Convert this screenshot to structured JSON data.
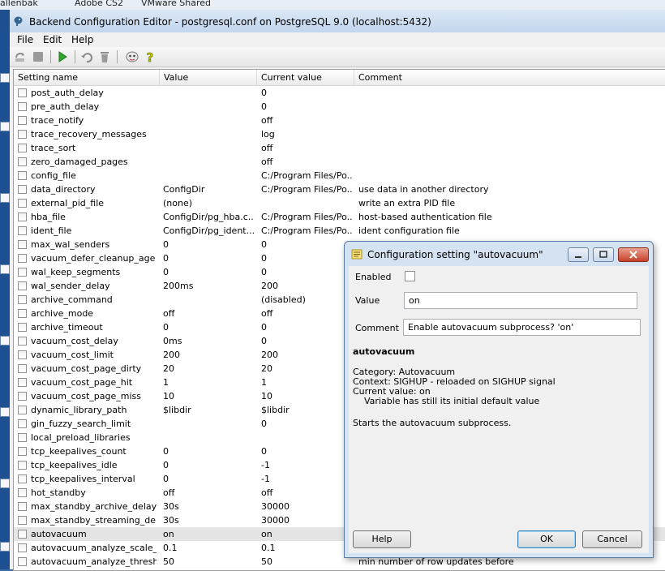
{
  "desktop": {
    "labels": [
      "allenbak",
      "Adobe CS2",
      "VMware Shared"
    ]
  },
  "window": {
    "title": "Backend Configuration Editor - postgresql.conf on PostgreSQL 9.0 (localhost:5432)"
  },
  "menu": [
    "File",
    "Edit",
    "Help"
  ],
  "columns": [
    "Setting name",
    "Value",
    "Current value",
    "Comment"
  ],
  "rows": [
    {
      "name": "post_auth_delay",
      "value": "",
      "current": "0",
      "comment": ""
    },
    {
      "name": "pre_auth_delay",
      "value": "",
      "current": "0",
      "comment": ""
    },
    {
      "name": "trace_notify",
      "value": "",
      "current": "off",
      "comment": ""
    },
    {
      "name": "trace_recovery_messages",
      "value": "",
      "current": "log",
      "comment": ""
    },
    {
      "name": "trace_sort",
      "value": "",
      "current": "off",
      "comment": ""
    },
    {
      "name": "zero_damaged_pages",
      "value": "",
      "current": "off",
      "comment": ""
    },
    {
      "name": "config_file",
      "value": "",
      "current": "C:/Program Files/Po...",
      "comment": ""
    },
    {
      "name": "data_directory",
      "value": "ConfigDir",
      "current": "C:/Program Files/Po...",
      "comment": "use data in another directory"
    },
    {
      "name": "external_pid_file",
      "value": "(none)",
      "current": "",
      "comment": "write an extra PID file"
    },
    {
      "name": "hba_file",
      "value": "ConfigDir/pg_hba.c...",
      "current": "C:/Program Files/Po...",
      "comment": "host-based authentication file"
    },
    {
      "name": "ident_file",
      "value": "ConfigDir/pg_ident....",
      "current": "C:/Program Files/Po...",
      "comment": "ident configuration file"
    },
    {
      "name": "max_wal_senders",
      "value": "0",
      "current": "0",
      "comment": ""
    },
    {
      "name": "vacuum_defer_cleanup_age",
      "value": "0",
      "current": "0",
      "comment": ""
    },
    {
      "name": "wal_keep_segments",
      "value": "0",
      "current": "0",
      "comment": ""
    },
    {
      "name": "wal_sender_delay",
      "value": "200ms",
      "current": "200",
      "comment": ""
    },
    {
      "name": "archive_command",
      "value": "",
      "current": "(disabled)",
      "comment": ""
    },
    {
      "name": "archive_mode",
      "value": "off",
      "current": "off",
      "comment": ""
    },
    {
      "name": "archive_timeout",
      "value": "0",
      "current": "0",
      "comment": ""
    },
    {
      "name": "vacuum_cost_delay",
      "value": "0ms",
      "current": "0",
      "comment": ""
    },
    {
      "name": "vacuum_cost_limit",
      "value": "200",
      "current": "200",
      "comment": ""
    },
    {
      "name": "vacuum_cost_page_dirty",
      "value": "20",
      "current": "20",
      "comment": ""
    },
    {
      "name": "vacuum_cost_page_hit",
      "value": "1",
      "current": "1",
      "comment": ""
    },
    {
      "name": "vacuum_cost_page_miss",
      "value": "10",
      "current": "10",
      "comment": ""
    },
    {
      "name": "dynamic_library_path",
      "value": "$libdir",
      "current": "$libdir",
      "comment": ""
    },
    {
      "name": "gin_fuzzy_search_limit",
      "value": "",
      "current": "0",
      "comment": ""
    },
    {
      "name": "local_preload_libraries",
      "value": "",
      "current": "",
      "comment": ""
    },
    {
      "name": "tcp_keepalives_count",
      "value": "0",
      "current": "0",
      "comment": ""
    },
    {
      "name": "tcp_keepalives_idle",
      "value": "0",
      "current": "-1",
      "comment": ""
    },
    {
      "name": "tcp_keepalives_interval",
      "value": "0",
      "current": "-1",
      "comment": ""
    },
    {
      "name": "hot_standby",
      "value": "off",
      "current": "off",
      "comment": ""
    },
    {
      "name": "max_standby_archive_delay",
      "value": "30s",
      "current": "30000",
      "comment": ""
    },
    {
      "name": "max_standby_streaming_delay",
      "value": "30s",
      "current": "30000",
      "comment": ""
    },
    {
      "name": "autovacuum",
      "value": "on",
      "current": "on",
      "comment": "",
      "selected": true
    },
    {
      "name": "autovacuum_analyze_scale_f...",
      "value": "0.1",
      "current": "0.1",
      "comment": ""
    },
    {
      "name": "autovacuum_analyze_threshold",
      "value": "50",
      "current": "50",
      "comment": "min number of row updates before"
    }
  ],
  "dialog": {
    "title": "Configuration setting \"autovacuum\"",
    "enabled_label": "Enabled",
    "value_label": "Value",
    "value": "on",
    "comment_label": "Comment",
    "comment": "Enable autovacuum subprocess?  'on'",
    "info_title": "autovacuum",
    "info_lines": [
      "Category: Autovacuum",
      "Context: SIGHUP - reloaded on SIGHUP signal",
      "Current value: on",
      "    Variable has still its initial default value",
      "",
      "Starts the autovacuum subprocess."
    ],
    "help_label": "Help",
    "ok_label": "OK",
    "cancel_label": "Cancel"
  },
  "colors": {
    "titlebar": "#c2d6ee",
    "selected_row": "#e4e4e4",
    "close_button": "#c7412a"
  }
}
